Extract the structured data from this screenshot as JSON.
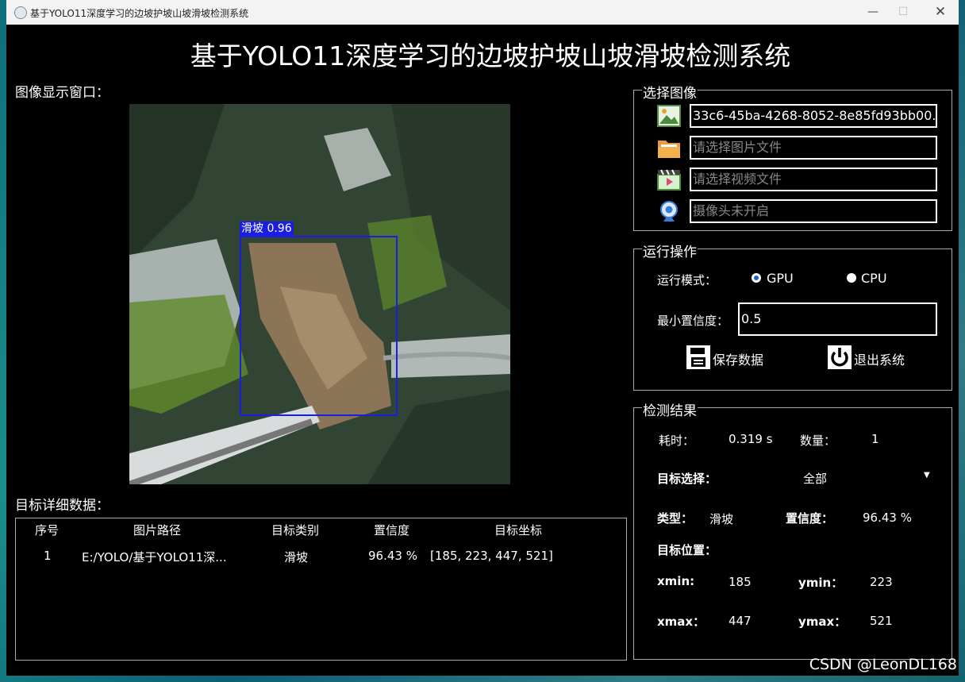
{
  "window": {
    "title": "基于YOLO11深度学习的边坡护坡山坡滑坡检测系统"
  },
  "header": {
    "title": "基于YOLO11深度学习的边坡护坡山坡滑坡检测系统"
  },
  "display": {
    "label": "图像显示窗口：",
    "detection_label": "滑坡 0.96"
  },
  "details": {
    "label": "目标详细数据：",
    "columns": [
      "序号",
      "图片路径",
      "目标类别",
      "置信度",
      "目标坐标"
    ],
    "rows": [
      [
        "1",
        "E:/YOLO/基于YOLO11深...",
        "滑坡",
        "96.43 %",
        "[185, 223, 447, 521]"
      ]
    ]
  },
  "select_image": {
    "title": "选择图像",
    "image_file_value": "33c6-45ba-4268-8052-8e85fd93bb00.jpg",
    "folder_placeholder": "请选择图片文件",
    "video_placeholder": "请选择视频文件",
    "camera_placeholder": "摄像头未开启"
  },
  "run": {
    "title": "运行操作",
    "mode_label": "运行模式：",
    "mode_options": [
      "GPU",
      "CPU"
    ],
    "mode_selected": "GPU",
    "conf_label": "最小置信度：",
    "conf_value": "0.5",
    "save_label": "保存数据",
    "exit_label": "退出系统"
  },
  "results": {
    "title": "检测结果",
    "time_label": "耗时：",
    "time_value": "0.319 s",
    "count_label": "数量：",
    "count_value": "1",
    "target_select_label": "目标选择：",
    "target_select_value": "全部",
    "type_label": "类型：",
    "type_value": "滑坡",
    "conf_label": "置信度：",
    "conf_value": "96.43 %",
    "position_label": "目标位置：",
    "xmin_label": "xmin:",
    "xmin_value": "185",
    "ymin_label": "ymin：",
    "ymin_value": "223",
    "xmax_label": "xmax：",
    "xmax_value": "447",
    "ymax_label": "ymax：",
    "ymax_value": "521"
  },
  "watermark": "CSDN @LeonDL168",
  "colors": {
    "accent": "#1a1ee0",
    "radio_on": "#1565c0",
    "background": "#000000"
  },
  "icons": [
    "image-icon",
    "folder-icon",
    "video-icon",
    "webcam-icon",
    "save-icon",
    "power-icon"
  ]
}
